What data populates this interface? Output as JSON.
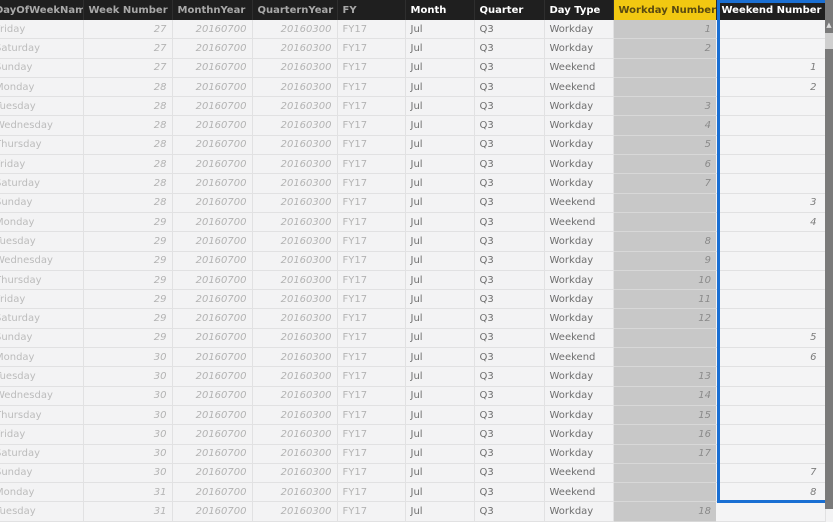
{
  "table": {
    "columns": [
      {
        "key": "dayname",
        "label": "DayOfWeekName"
      },
      {
        "key": "week",
        "label": "Week Number"
      },
      {
        "key": "monthyear",
        "label": "MonthnYear"
      },
      {
        "key": "quarteryear",
        "label": "QuarternYear"
      },
      {
        "key": "fy",
        "label": "FY"
      },
      {
        "key": "month",
        "label": "Month"
      },
      {
        "key": "quarter",
        "label": "Quarter"
      },
      {
        "key": "daytype",
        "label": "Day Type"
      },
      {
        "key": "workday",
        "label": "Workday Number"
      },
      {
        "key": "weekend",
        "label": "Weekend Number"
      }
    ],
    "rows": [
      {
        "dayname": "Friday",
        "week": "27",
        "monthyear": "20160700",
        "quarteryear": "20160300",
        "fy": "FY17",
        "month": "Jul",
        "quarter": "Q3",
        "daytype": "Workday",
        "workday": "1",
        "weekend": ""
      },
      {
        "dayname": "Saturday",
        "week": "27",
        "monthyear": "20160700",
        "quarteryear": "20160300",
        "fy": "FY17",
        "month": "Jul",
        "quarter": "Q3",
        "daytype": "Workday",
        "workday": "2",
        "weekend": ""
      },
      {
        "dayname": "Sunday",
        "week": "27",
        "monthyear": "20160700",
        "quarteryear": "20160300",
        "fy": "FY17",
        "month": "Jul",
        "quarter": "Q3",
        "daytype": "Weekend",
        "workday": "",
        "weekend": "1"
      },
      {
        "dayname": "Monday",
        "week": "28",
        "monthyear": "20160700",
        "quarteryear": "20160300",
        "fy": "FY17",
        "month": "Jul",
        "quarter": "Q3",
        "daytype": "Weekend",
        "workday": "",
        "weekend": "2"
      },
      {
        "dayname": "Tuesday",
        "week": "28",
        "monthyear": "20160700",
        "quarteryear": "20160300",
        "fy": "FY17",
        "month": "Jul",
        "quarter": "Q3",
        "daytype": "Workday",
        "workday": "3",
        "weekend": ""
      },
      {
        "dayname": "Wednesday",
        "week": "28",
        "monthyear": "20160700",
        "quarteryear": "20160300",
        "fy": "FY17",
        "month": "Jul",
        "quarter": "Q3",
        "daytype": "Workday",
        "workday": "4",
        "weekend": ""
      },
      {
        "dayname": "Thursday",
        "week": "28",
        "monthyear": "20160700",
        "quarteryear": "20160300",
        "fy": "FY17",
        "month": "Jul",
        "quarter": "Q3",
        "daytype": "Workday",
        "workday": "5",
        "weekend": ""
      },
      {
        "dayname": "Friday",
        "week": "28",
        "monthyear": "20160700",
        "quarteryear": "20160300",
        "fy": "FY17",
        "month": "Jul",
        "quarter": "Q3",
        "daytype": "Workday",
        "workday": "6",
        "weekend": ""
      },
      {
        "dayname": "Saturday",
        "week": "28",
        "monthyear": "20160700",
        "quarteryear": "20160300",
        "fy": "FY17",
        "month": "Jul",
        "quarter": "Q3",
        "daytype": "Workday",
        "workday": "7",
        "weekend": ""
      },
      {
        "dayname": "Sunday",
        "week": "28",
        "monthyear": "20160700",
        "quarteryear": "20160300",
        "fy": "FY17",
        "month": "Jul",
        "quarter": "Q3",
        "daytype": "Weekend",
        "workday": "",
        "weekend": "3"
      },
      {
        "dayname": "Monday",
        "week": "29",
        "monthyear": "20160700",
        "quarteryear": "20160300",
        "fy": "FY17",
        "month": "Jul",
        "quarter": "Q3",
        "daytype": "Weekend",
        "workday": "",
        "weekend": "4"
      },
      {
        "dayname": "Tuesday",
        "week": "29",
        "monthyear": "20160700",
        "quarteryear": "20160300",
        "fy": "FY17",
        "month": "Jul",
        "quarter": "Q3",
        "daytype": "Workday",
        "workday": "8",
        "weekend": ""
      },
      {
        "dayname": "Wednesday",
        "week": "29",
        "monthyear": "20160700",
        "quarteryear": "20160300",
        "fy": "FY17",
        "month": "Jul",
        "quarter": "Q3",
        "daytype": "Workday",
        "workday": "9",
        "weekend": ""
      },
      {
        "dayname": "Thursday",
        "week": "29",
        "monthyear": "20160700",
        "quarteryear": "20160300",
        "fy": "FY17",
        "month": "Jul",
        "quarter": "Q3",
        "daytype": "Workday",
        "workday": "10",
        "weekend": ""
      },
      {
        "dayname": "Friday",
        "week": "29",
        "monthyear": "20160700",
        "quarteryear": "20160300",
        "fy": "FY17",
        "month": "Jul",
        "quarter": "Q3",
        "daytype": "Workday",
        "workday": "11",
        "weekend": ""
      },
      {
        "dayname": "Saturday",
        "week": "29",
        "monthyear": "20160700",
        "quarteryear": "20160300",
        "fy": "FY17",
        "month": "Jul",
        "quarter": "Q3",
        "daytype": "Workday",
        "workday": "12",
        "weekend": ""
      },
      {
        "dayname": "Sunday",
        "week": "29",
        "monthyear": "20160700",
        "quarteryear": "20160300",
        "fy": "FY17",
        "month": "Jul",
        "quarter": "Q3",
        "daytype": "Weekend",
        "workday": "",
        "weekend": "5"
      },
      {
        "dayname": "Monday",
        "week": "30",
        "monthyear": "20160700",
        "quarteryear": "20160300",
        "fy": "FY17",
        "month": "Jul",
        "quarter": "Q3",
        "daytype": "Weekend",
        "workday": "",
        "weekend": "6"
      },
      {
        "dayname": "Tuesday",
        "week": "30",
        "monthyear": "20160700",
        "quarteryear": "20160300",
        "fy": "FY17",
        "month": "Jul",
        "quarter": "Q3",
        "daytype": "Workday",
        "workday": "13",
        "weekend": ""
      },
      {
        "dayname": "Wednesday",
        "week": "30",
        "monthyear": "20160700",
        "quarteryear": "20160300",
        "fy": "FY17",
        "month": "Jul",
        "quarter": "Q3",
        "daytype": "Workday",
        "workday": "14",
        "weekend": ""
      },
      {
        "dayname": "Thursday",
        "week": "30",
        "monthyear": "20160700",
        "quarteryear": "20160300",
        "fy": "FY17",
        "month": "Jul",
        "quarter": "Q3",
        "daytype": "Workday",
        "workday": "15",
        "weekend": ""
      },
      {
        "dayname": "Friday",
        "week": "30",
        "monthyear": "20160700",
        "quarteryear": "20160300",
        "fy": "FY17",
        "month": "Jul",
        "quarter": "Q3",
        "daytype": "Workday",
        "workday": "16",
        "weekend": ""
      },
      {
        "dayname": "Saturday",
        "week": "30",
        "monthyear": "20160700",
        "quarteryear": "20160300",
        "fy": "FY17",
        "month": "Jul",
        "quarter": "Q3",
        "daytype": "Workday",
        "workday": "17",
        "weekend": ""
      },
      {
        "dayname": "Sunday",
        "week": "30",
        "monthyear": "20160700",
        "quarteryear": "20160300",
        "fy": "FY17",
        "month": "Jul",
        "quarter": "Q3",
        "daytype": "Weekend",
        "workday": "",
        "weekend": "7"
      },
      {
        "dayname": "Monday",
        "week": "31",
        "monthyear": "20160700",
        "quarteryear": "20160300",
        "fy": "FY17",
        "month": "Jul",
        "quarter": "Q3",
        "daytype": "Weekend",
        "workday": "",
        "weekend": "8"
      },
      {
        "dayname": "Tuesday",
        "week": "31",
        "monthyear": "20160700",
        "quarteryear": "20160300",
        "fy": "FY17",
        "month": "Jul",
        "quarter": "Q3",
        "daytype": "Workday",
        "workday": "18",
        "weekend": ""
      }
    ]
  },
  "highlight": {
    "column": "Weekend Number",
    "color": "#1a6fd3"
  },
  "colors": {
    "header_bg": "#1f1f1f",
    "selected_header": "#f2c811",
    "selected_column_bg": "#c8c8c8"
  }
}
